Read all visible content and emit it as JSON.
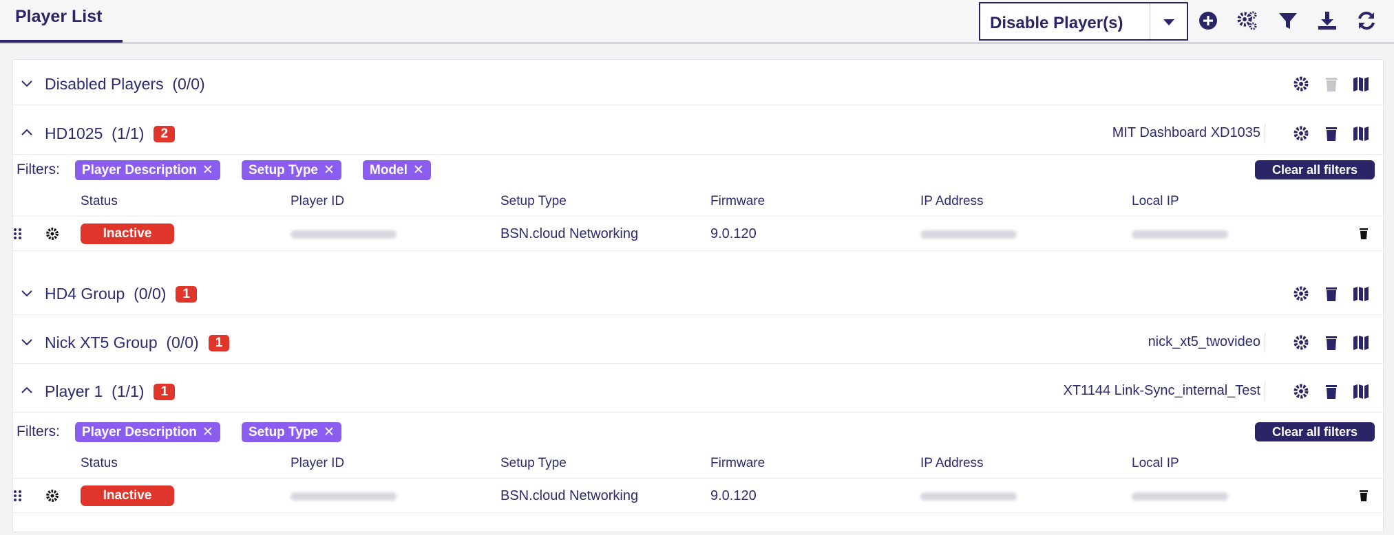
{
  "header": {
    "tab_label": "Player List",
    "action_dropdown": "Disable Player(s)",
    "icons": [
      "add-circle-icon",
      "gears-icon",
      "filter-icon",
      "download-icon",
      "refresh-icon"
    ]
  },
  "columns": [
    "Status",
    "Player ID",
    "Setup Type",
    "Firmware",
    "IP Address",
    "Local IP"
  ],
  "filters_label": "Filters:",
  "clear_filters_label": "Clear all filters",
  "groups": [
    {
      "name": "Disabled Players",
      "count": "(0/0)",
      "badge": "",
      "description": ""
    },
    {
      "name": "HD1025",
      "count": "(1/1)",
      "badge": "2",
      "description": "MIT Dashboard XD1035",
      "filters": [
        "Player Description",
        "Setup Type",
        "Model"
      ],
      "rows": [
        {
          "status": "Inactive",
          "setup_type": "BSN.cloud Networking",
          "firmware": "9.0.120"
        }
      ]
    },
    {
      "name": "HD4 Group",
      "count": "(0/0)",
      "badge": "1",
      "description": ""
    },
    {
      "name": "Nick XT5 Group",
      "count": "(0/0)",
      "badge": "1",
      "description": "nick_xt5_twovideo"
    },
    {
      "name": "Player 1",
      "count": "(1/1)",
      "badge": "1",
      "description": "XT1144 Link-Sync_internal_Test",
      "filters": [
        "Player Description",
        "Setup Type"
      ],
      "rows": [
        {
          "status": "Inactive",
          "setup_type": "BSN.cloud Networking",
          "firmware": "9.0.120"
        }
      ]
    }
  ],
  "colors": {
    "primary": "#2a2566",
    "chip": "#8b5cf0",
    "danger": "#e0352b"
  }
}
